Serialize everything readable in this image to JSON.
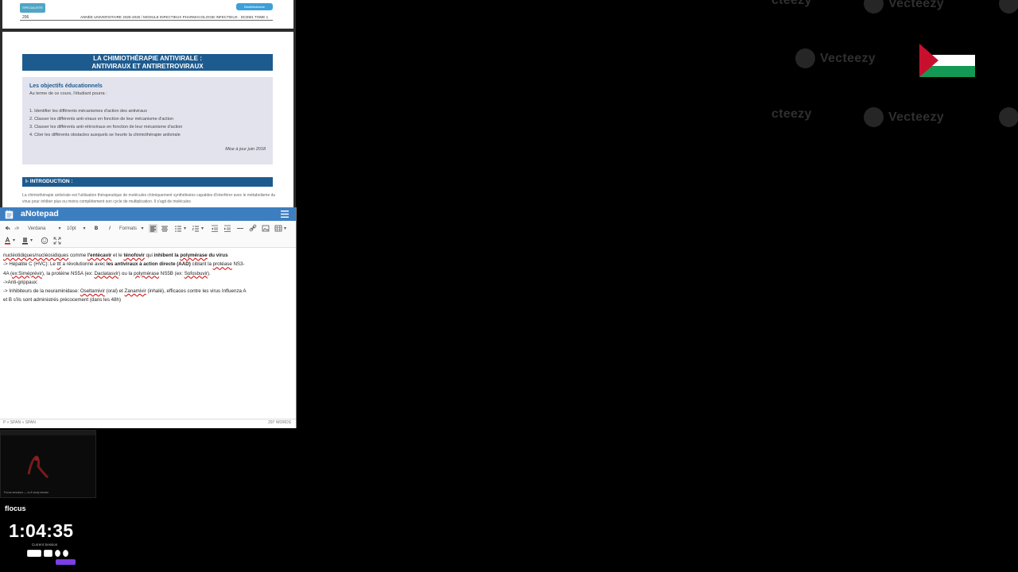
{
  "pdf": {
    "header_tag_left": "SPECIALISTE UNIVERSITAIRE",
    "header_tag_right": "Bio&Medecine",
    "page_number": "206",
    "running_header": "ANNÉE UNIVERSITAIRE 2025-2026 / MODULE INFECTIEUX PHARMACOLOGIE INFECTIEUX · DCEM1 TOME 1",
    "title_line1": "LA CHIMIOTHÉRAPIE ANTIVIRALE :",
    "title_line2": "ANTIVIRAUX ET ANTIRETROVIRAUX",
    "objectives_title": "Les objectifs éducationnels",
    "objectives_intro": "Au terme de ce cours, l'étudiant pourra :",
    "objectives": [
      "1. Identifier les différents mécanismes d'action des antiviraux",
      "2. Classer les différents anti-viraux en fonction de leur mécanisme d'action",
      "3. Classer les différents anti-rétroviraux en fonction de leur mécanisme d'action",
      "4. Citer les différents obstacles auxquels se heurte la chimiothérapie antivirale"
    ],
    "update_date": "Mise à jour juin 2018",
    "intro_heading": "I- INTRODUCTION :",
    "intro_text": "La chimiothérapie antivirale est l'utilisation thérapeutique de molécules chimiquement synthétisées capables d'interférer avec le métabolisme du virus pour inhiber plus ou moins complètement son cycle de multiplication. Il s'agit de molécules"
  },
  "notepad": {
    "app_name": "aNotepad",
    "toolbar": {
      "font": "Verdana",
      "size": "10pt",
      "bold": "B",
      "italic": "I",
      "formats": "Formats"
    },
    "lines": {
      "l1_a": "nucléotidiques/nucléosidiques",
      "l1_b": " comme ",
      "l1_c": "l'entécavir",
      "l1_d": " et le ",
      "l1_e": "ténofovir",
      "l1_f": " qui ",
      "l1_g": "inhibent la ",
      "l1_h": "polymérase",
      "l1_i": " du virus",
      "l2_a": "   -> Hépatite C (HVC): Le ",
      "l2_b": "ttt",
      "l2_c": " a révolutionné avec ",
      "l2_d": "les antiviraux à action directe (AAD)",
      "l2_e": " ciblant la ",
      "l2_f": "protéase",
      "l2_g": " NS3-",
      "l3_a": "4A (",
      "l3_b": "ex:Siméprévir",
      "l3_c": "), la protéine NS5A (ex: ",
      "l3_d": "Daclatasvir",
      "l3_e": ") ou la ",
      "l3_f": "polymérase",
      "l3_g": " NS5B (ex: ",
      "l3_h": "Sofosbuvir",
      "l3_i": ").",
      "l4": "->Anti-grippaux:",
      "l5_a": "   -> Inhibiteurs de la neuraminidase: ",
      "l5_b": "Oseltamivir",
      "l5_c": " (oral) et ",
      "l5_d": "Zanamivir",
      "l5_e": " (inhalé), efficaces contre les virus Influenza A",
      "l6": "et B s'ils sont administrés précocement (dans les 48h)"
    },
    "status_path": "P » SPAN » SPAN",
    "status_words": "297 WORDS"
  },
  "watermark": {
    "text": "Vecteezy",
    "partial": "cteezy"
  },
  "video": {
    "caption": "Focus sessions — lo-fi study stream"
  },
  "flocus": {
    "name": "flocus",
    "timer": "1:04:35",
    "sub": "Current Session"
  },
  "colors": {
    "accent": "#3d7ec1",
    "pdf_blue": "#1d5b8f",
    "flag_red": "#c8102e",
    "flag_green": "#149954"
  }
}
